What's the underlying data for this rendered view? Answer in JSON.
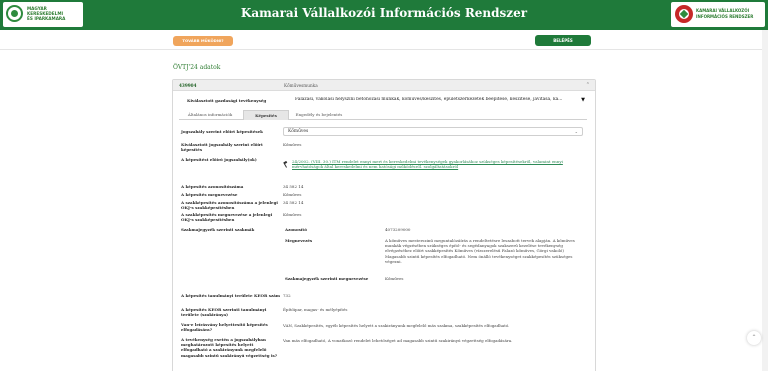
{
  "header": {
    "title": "Kamarai Vállalkozói Információs Rendszer",
    "logo_left_text": "MAGYAR\nKERESKEDELMI\nÉS IPARKAMARA",
    "logo_right_text": "KAMARAI VÁLLALKOZÓI\nINFORMÁCIÓS RENDSZER"
  },
  "toolbar": {
    "left_button": "TOVÁBB MŰKÖDNI?",
    "login_button": "BELÉPÉS"
  },
  "section_title": "ÖVTJ'24 adatok",
  "accordion": {
    "id": "439904",
    "name": "Kőművesmunka",
    "chevron": "⌃"
  },
  "activity": {
    "label": "Kiválasztott gazdasági tevékenység",
    "value": "Falazási, vakolási helyszíni betonozási munkák, kőműves/készítés, épületszerkezetek beépítése, készítése, javítása, ka..."
  },
  "tabs": [
    "Általános információk",
    "Képesítés",
    "Engedély és bejelentés"
  ],
  "qualification": {
    "select_label": "Jogszabály szerint előírt képesítések",
    "select_value": "Kőműves",
    "rows": [
      {
        "label": "Kiválasztott jogszabály szerint előírt képesítés",
        "value": "Kőműves"
      },
      {
        "label": "A képesítést előíró jogszabály(ok)",
        "value": "24/2002. (VIII. 30.) ITM rendelet ennyi mert és kereskedelmi tevékenységek gyakorlásához szükséges képesítésekről, valamint ennyi mérvhatóságok által kereskedelmi és nem hatósági működésről. szolgáltatásokról"
      },
      {
        "label": "A képesítés azonosítószáma",
        "value": "34 582 14"
      },
      {
        "label": "A képesítés megnevezése",
        "value": "Kőműves"
      },
      {
        "label": "A szakképesítés azonosítószáma a jelenlegi OKJ-s szakképesítésben",
        "value": "34 582 14"
      },
      {
        "label": "A szakképesítés megnevezése a jelenlegi OKJ-s szakképesítésben",
        "value": "Kőműves"
      },
      {
        "label": "Szakmajegyzék szerinti szakmák",
        "value": ""
      }
    ],
    "szakma": {
      "azonosito_label": "Azonosító",
      "azonosito_value": "4073209000",
      "megnevezes_label": "Megnevezés",
      "megnevezes_value": "A kőműves mesterszinű meguntalózáírás a rendeltetésre leszabott tervek alapján. A kőműves munkák végzésében szükséges építő- és segédanyagok szakszerű kezelése tevékenység elvégzéséhez előírt szakképesítés Kőműves (vízszerelésű Falazó kőműves, Görgi vakoló) Magasabb szintű képesítés elfogadható. Nem önálló tevékenységet szakképesítés szükséges végezni.",
      "szakmajegyzek_label": "Szakmajegyzék szerinti megnevezése",
      "szakmajegyzek_value": "Kőműves"
    },
    "lower_rows": [
      {
        "label": "A képesítés tanulmányi területe KEOR szám",
        "value": "732"
      },
      {
        "label": "A képesítés KEOR szerinti tanulmányi területe (szakiránya)",
        "value": "Építőipar, magas- és mélyépítés"
      },
      {
        "label": "Van-e leírásvány helyettesítő képesítés elfogadására?",
        "value": "VAN, Szakképesítés, egyéb képesítés helyett a szakirányunk megfelelő más szakma, szakképesítés elfogadható."
      },
      {
        "label": "A tevékenység esetén a jogszabályban meghatározott képesítés helyett elfogadható a szakirányunk megfelelő magasabb szintű szakirányú végzettség is?",
        "value": "Van más elfogadható, A vonatkozó rendelet lehetőséget ad magasabb szintű szakirányú végzettség elfogadására."
      }
    ]
  },
  "fab_icon": "up-arrow"
}
